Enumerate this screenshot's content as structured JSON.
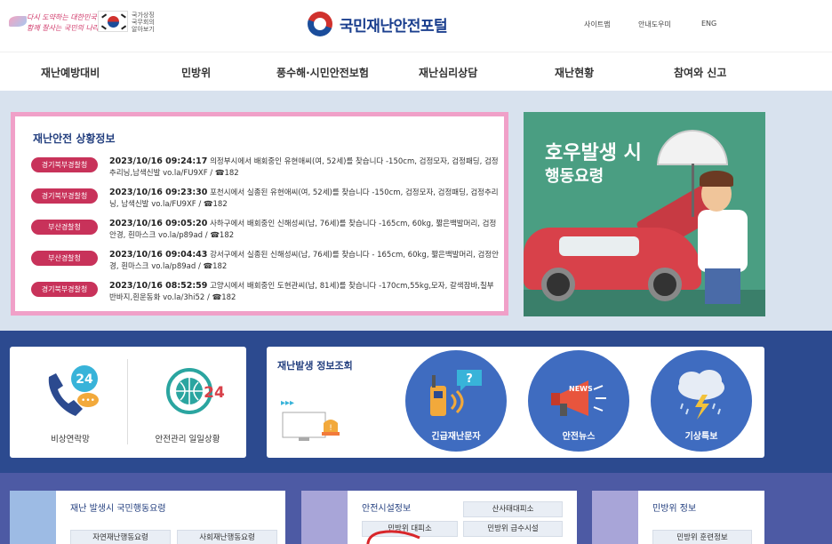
{
  "header": {
    "slogan_line1": "다시 도약하는 대한민국",
    "slogan_line2": "함께 잘사는 국민의 나라",
    "flag_text": [
      "국가상징",
      "국무회의",
      "알아보기"
    ],
    "portal_title": "국민재난안전포털",
    "util_links": [
      "사이트맵",
      "안내도우미",
      "ENG"
    ]
  },
  "nav": {
    "items": [
      "재난예방대비",
      "민방위",
      "풍수해·시민안전보험",
      "재난심리상담",
      "재난현황",
      "참여와 신고"
    ]
  },
  "status": {
    "title": "재난안전 상황정보",
    "items": [
      {
        "badge": "경기북부경찰청",
        "datetime": "2023/10/16 09:24:17",
        "text": " 의정부시에서 배회중인 유현애씨(여, 52세)를 찾습니다 -150cm, 검정모자, 검정패딩, 검정추리닝,남색신발 vo.la/FU9XF / ☎182"
      },
      {
        "badge": "경기북부경찰청",
        "datetime": "2023/10/16 09:23:30",
        "text": " 포천시에서 실종된 유현애씨(여, 52세)를 찾습니다 -150cm, 검정모자, 검정패딩, 검정추리닝, 남색신발 vo.la/FU9XF / ☎182"
      },
      {
        "badge": "부산경찰청",
        "datetime": "2023/10/16 09:05:20",
        "text": " 사하구에서 배회중인 신해성씨(남, 76세)를 찾습니다 -165cm, 60kg, 짧은백발머리, 검정안경, 흰마스크 vo.la/p89ad / ☎182"
      },
      {
        "badge": "부산경찰청",
        "datetime": "2023/10/16 09:04:43",
        "text": " 강서구에서 실종된 신해성씨(남, 76세)를 찾습니다 - 165cm, 60kg, 짧은백발머리, 검정안경, 흰마스크 vo.la/p89ad / ☎182"
      },
      {
        "badge": "경기북부경찰청",
        "datetime": "2023/10/16 08:52:59",
        "text": " 고양시에서 배회중인 도현관씨(남, 81세)를 찾습니다 -170cm,55kg,모자, 갈색잠바,칠부반바지,흰운동화 vo.la/3hi52 / ☎182"
      }
    ]
  },
  "banner": {
    "line1": "호우발생 시",
    "line2": "행동요령"
  },
  "quick": {
    "emergency_label": "비상연락망",
    "daily_label": "안전관리 일일상황",
    "phone_badge": "24",
    "globe_badge": "24"
  },
  "disaster_info": {
    "title": "재난발생 정보조회",
    "circles": [
      "긴급재난문자",
      "안전뉴스",
      "기상특보"
    ],
    "news_badge": "NEWS"
  },
  "cards": {
    "card1": {
      "title": "재난 발생시 국민행동요령",
      "pills": [
        "자연재난행동요령",
        "사회재난행동요령"
      ]
    },
    "card2": {
      "title": "안전시설정보",
      "pills": [
        "산사태대피소",
        "민방위 대피소",
        "민방위 급수시설"
      ]
    },
    "card3": {
      "title": "민방위 정보",
      "pills": [
        "민방위 훈련정보"
      ]
    }
  },
  "colors": {
    "primary_navy": "#1b3f8e",
    "badge_red": "#c8325a",
    "status_border": "#f0a0c8",
    "band2_bg": "#2c4a8f",
    "circle_blue": "#3f6cc0"
  }
}
